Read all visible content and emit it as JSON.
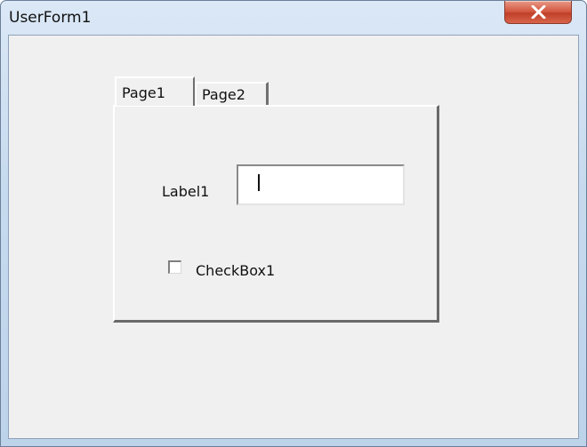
{
  "window": {
    "title": "UserForm1",
    "close_icon": "close-x-icon"
  },
  "multipage": {
    "tabs": [
      {
        "label": "Page1",
        "selected": true
      },
      {
        "label": "Page2",
        "selected": false
      }
    ]
  },
  "page1": {
    "label1": "Label1",
    "textbox_value": "",
    "checkbox_label": "CheckBox1",
    "checkbox_checked": false
  },
  "colors": {
    "title_bar": "#c7dbef",
    "form_background": "#f0f0f0",
    "close_button": "#c94a33"
  }
}
